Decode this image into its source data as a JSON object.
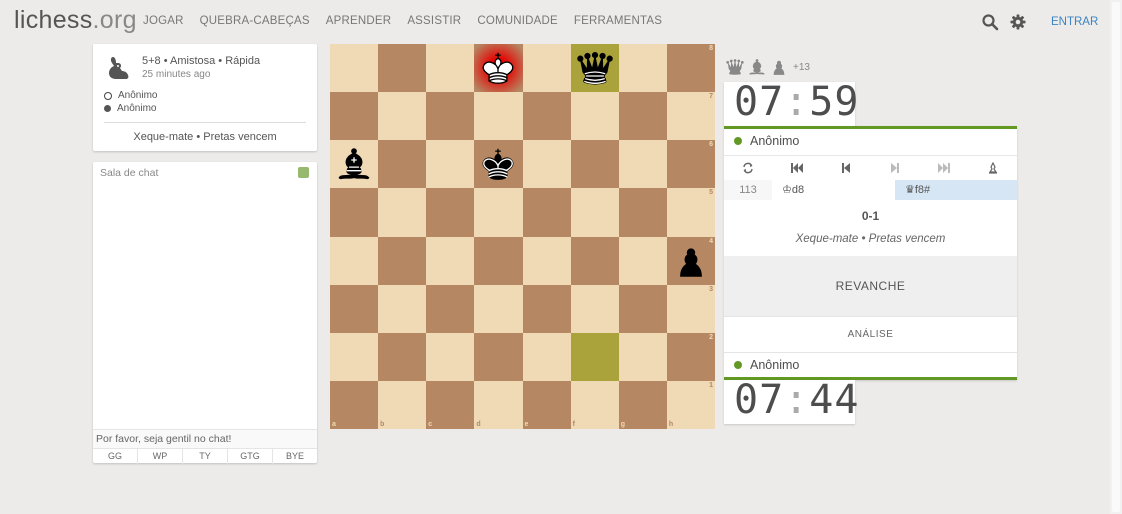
{
  "header": {
    "logo_main": "lichess",
    "logo_suffix": ".org",
    "nav": [
      "JOGAR",
      "QUEBRA-CABEÇAS",
      "APRENDER",
      "ASSISTIR",
      "COMUNIDADE",
      "FERRAMENTAS"
    ],
    "signin_label": "ENTRAR"
  },
  "game_info": {
    "setup": "5+8 • Amistosa • Rápida",
    "time_ago": "25 minutes ago",
    "white_player": "Anônimo",
    "black_player": "Anônimo",
    "status": "Xeque-mate • Pretas vencem"
  },
  "chat": {
    "title": "Sala de chat",
    "placeholder": "Por favor, seja gentil no chat!",
    "presets": [
      "GG",
      "WP",
      "TY",
      "GTG",
      "BYE"
    ]
  },
  "board": {
    "files": [
      "a",
      "b",
      "c",
      "d",
      "e",
      "f",
      "g",
      "h"
    ],
    "ranks": [
      "8",
      "7",
      "6",
      "5",
      "4",
      "3",
      "2",
      "1"
    ],
    "pieces": [
      {
        "square": "d8",
        "piece": "white-king"
      },
      {
        "square": "f8",
        "piece": "black-queen"
      },
      {
        "square": "a6",
        "piece": "black-bishop"
      },
      {
        "square": "d6",
        "piece": "black-king"
      },
      {
        "square": "h4",
        "piece": "black-pawn"
      }
    ],
    "last_move": [
      "f2",
      "f8"
    ],
    "check_square": "d8",
    "colors": {
      "light": "#f0d9b5",
      "dark": "#b58863",
      "highlight_dark": "#aaa23b",
      "check": "#ff0000"
    }
  },
  "material": {
    "pieces": [
      "queen-icon",
      "bishop-icon",
      "pawn-icon"
    ],
    "diff": "+13"
  },
  "clock_top": {
    "minutes": "07",
    "seconds": "59"
  },
  "clock_bottom": {
    "minutes": "07",
    "seconds": "44"
  },
  "controls": {
    "top_player": "Anônimo",
    "bottom_player": "Anônimo",
    "move_number": "113",
    "white_move": "♔d8",
    "black_move": "♛f8#",
    "result": "0-1",
    "result_status": "Xeque-mate • Pretas vencem",
    "rematch_label": "REVANCHE",
    "analysis_label": "ANÁLISE",
    "accent": "#629924"
  }
}
